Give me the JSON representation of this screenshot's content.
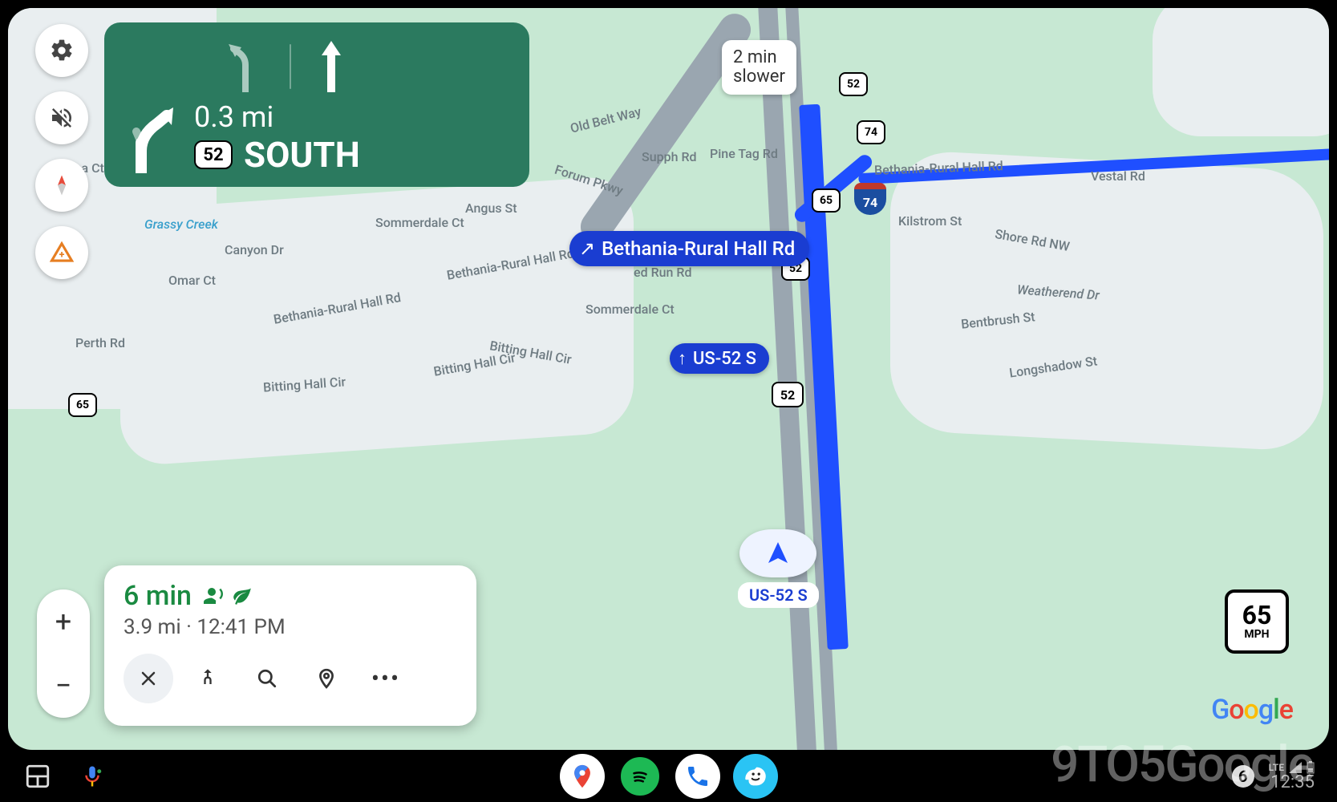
{
  "navigation": {
    "sign": {
      "distance": "0.3 mi",
      "route_shield": "52",
      "direction": "SOUTH"
    },
    "eta": {
      "time_remaining": "6 min",
      "distance": "3.9 mi",
      "arrival_separator": " · ",
      "arrival_time": "12:41 PM"
    },
    "alternate_route": {
      "label": "2 min\nslower"
    },
    "waypoints": {
      "exit": "Bethania-Rural Hall Rd",
      "continue": "US-52 S"
    },
    "current_road": "US-52 S",
    "speed_limit": {
      "value": "65",
      "unit": "MPH"
    }
  },
  "map_controls": {
    "zoom_in": "+",
    "zoom_out": "−"
  },
  "map_labels": {
    "shields": {
      "i74": "74",
      "r52": "52",
      "r65_a": "65",
      "r65_b": "65",
      "r52_b": "52"
    },
    "streets": {
      "helena": "Helena Ct",
      "grassy": "Grassy Creek",
      "canyon": "Canyon Dr",
      "omar": "Omar Ct",
      "perth": "Perth Rd",
      "bethania1": "Bethania-Rural Hall Rd",
      "bethania2": "Bethania-Rural Hall Rd",
      "bethania3": "Bethania-Rural Hall Rd",
      "bitting1": "Bitting Hall Cir",
      "bitting2": "Bitting Hall Cir",
      "bitting3": "Bitting Hall Cir",
      "sommerdale1": "Sommerdale Ct",
      "sommerdale2": "Sommerdale Ct",
      "angus": "Angus St",
      "forum": "Forum Pkwy",
      "red_run": "ed Run Rd",
      "supph": "Supph Rd",
      "old_belt": "Old Belt Way",
      "pinetag": "Pine Tag Rd",
      "kilstrom": "Kilstrom St",
      "shore": "Shore Rd NW",
      "weatherend": "Weatherend Dr",
      "bentbrush": "Bentbrush St",
      "longshadow": "Longshadow St",
      "vestal": "Vestal Rd"
    }
  },
  "dock": {
    "status_bar": {
      "network": "LTE",
      "time": "12:35",
      "notification_badge": "6"
    }
  },
  "branding": {
    "google": "Google",
    "watermark": "9TO5Google"
  }
}
